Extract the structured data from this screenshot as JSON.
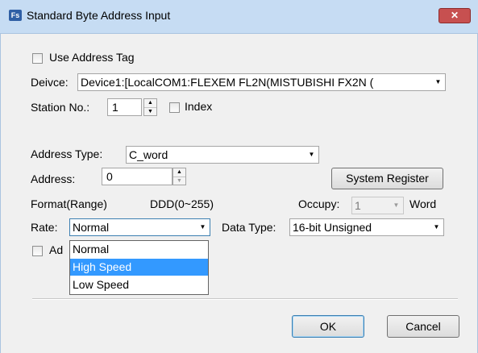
{
  "window": {
    "icon_text": "Fs",
    "title": "Standard Byte Address Input",
    "close_glyph": "✕"
  },
  "use_address_tag": {
    "label": "Use Address Tag",
    "checked": false
  },
  "device": {
    "label": "Deivce:",
    "value": "Device1:[LocalCOM1:FLEXEM FL2N(MISTUBISHI FX2N (",
    "arrow": "▼"
  },
  "station": {
    "label": "Station No.:",
    "value": "1",
    "index_label": "Index",
    "index_checked": false
  },
  "address_type": {
    "label": "Address Type:",
    "value": "C_word",
    "arrow": "▼"
  },
  "address": {
    "label": "Address:",
    "value": "0"
  },
  "system_register_button": "System Register",
  "format": {
    "label": "Format(Range)",
    "value": "DDD(0~255)"
  },
  "occupy": {
    "label": "Occupy:",
    "value": "1",
    "unit": "Word",
    "arrow": "▼"
  },
  "rate": {
    "label": "Rate:",
    "value": "Normal",
    "arrow": "▼",
    "options": [
      "Normal",
      "High Speed",
      "Low Speed"
    ],
    "highlighted": "High Speed"
  },
  "data_type": {
    "label": "Data Type:",
    "value": "16-bit Unsigned",
    "arrow": "▼"
  },
  "partial_checkbox_label": "Ad",
  "spin_up": "▲",
  "spin_down": "▼",
  "ok_button": "OK",
  "cancel_button": "Cancel",
  "colors": {
    "titlebar": "#c6dcf3",
    "close": "#c75050",
    "selection": "#3399ff",
    "frame": "#f0f0f0"
  }
}
